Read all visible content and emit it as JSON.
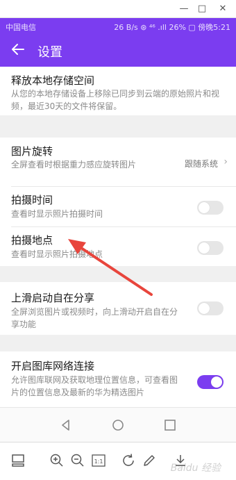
{
  "status": {
    "carrier": "中国电信",
    "right": "26 B/s ⊛ ⁴⁶ .ıll 26% ▢ 傍晚5:21"
  },
  "header": {
    "title": "设置"
  },
  "settings": [
    {
      "title": "释放本地存储空间",
      "desc": "从您的本地存储设备上移除已同步到云端的原始照片和视频，最近30天的文件将保留。"
    },
    {
      "title": "图片旋转",
      "desc": "全屏查看时根据重力感应旋转图片",
      "value": "跟随系统"
    },
    {
      "title": "拍摄时间",
      "desc": "查看时显示照片拍摄时间",
      "toggle": false
    },
    {
      "title": "拍摄地点",
      "desc": "查看时显示照片拍摄地点",
      "toggle": false
    },
    {
      "title": "上滑启动自在分享",
      "desc": "全屏浏览图片或视频时，向上滑动开启自在分享功能",
      "toggle": false
    },
    {
      "title": "开启图库网络连接",
      "desc": "允许图库联网及获取地理位置信息，可查看图片的位置信息及最新的华为精选图片",
      "toggle": true
    }
  ],
  "colors": {
    "accent": "#7b3df0",
    "arrow": "#e8453c"
  },
  "watermark": "Baidu 经验",
  "toolbar_icons": [
    "layout-icon",
    "zoom-in-icon",
    "zoom-out-icon",
    "actual-size-icon",
    "rotate-icon",
    "edit-icon",
    "download-icon"
  ],
  "toolbar": {
    "actual_size_label": "1:1"
  }
}
